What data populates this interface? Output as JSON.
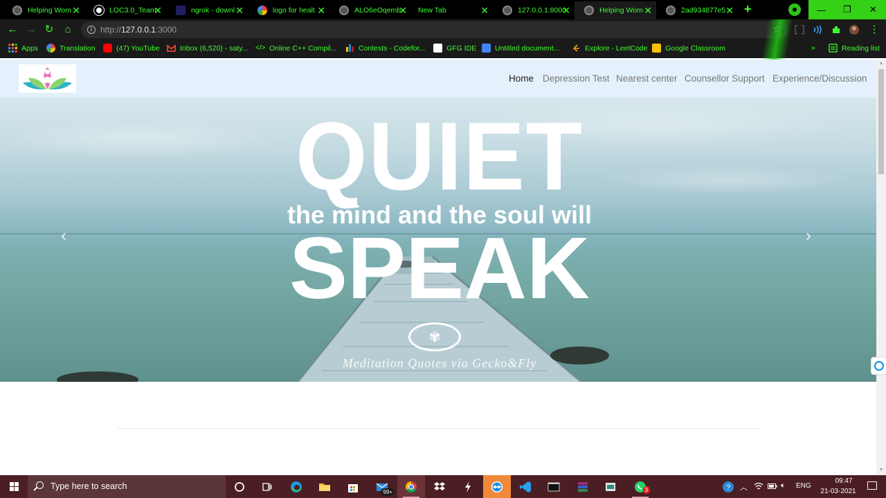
{
  "browser": {
    "tabs": [
      {
        "title": "Helping Wom",
        "favicon": "globe-icon"
      },
      {
        "title": "LOC3.0_Team",
        "favicon": "github-icon"
      },
      {
        "title": "ngrok - downl",
        "favicon": "ngrok-icon"
      },
      {
        "title": "logo for healt",
        "favicon": "google-icon"
      },
      {
        "title": "ALO6eOqemb",
        "favicon": "globe-icon"
      },
      {
        "title": "New Tab",
        "favicon": "none"
      },
      {
        "title": "127.0.0.1:8000",
        "favicon": "globe-icon"
      },
      {
        "title": "Helping Wom",
        "favicon": "globe-icon",
        "active": true
      },
      {
        "title": "2ad934877e5",
        "favicon": "globe-icon"
      }
    ],
    "url_host": "http://",
    "url_domain": "127.0.0.1",
    "url_port": ":3000",
    "accent_color": "#3dff2e",
    "bookmarks": [
      {
        "label": "Apps",
        "icon": "apps-grid-icon"
      },
      {
        "label": "Translation",
        "icon": "google-icon"
      },
      {
        "label": "(47) YouTube",
        "icon": "youtube-icon"
      },
      {
        "label": "Inbox (6,520) - saty...",
        "icon": "gmail-icon"
      },
      {
        "label": "Online C++ Compil...",
        "icon": "code-icon"
      },
      {
        "label": "Contests - Codefor...",
        "icon": "codeforces-icon"
      },
      {
        "label": "GFG IDE",
        "icon": "gfg-icon"
      },
      {
        "label": "Untitled document...",
        "icon": "docs-icon"
      },
      {
        "label": "Explore - LeetCode",
        "icon": "leetcode-icon"
      },
      {
        "label": "Google Classroom",
        "icon": "classroom-icon"
      }
    ],
    "reading_list": "Reading list",
    "overflow": "»"
  },
  "site": {
    "nav": [
      {
        "label": "Home",
        "active": true
      },
      {
        "label": "Depression Test"
      },
      {
        "label": "Nearest center"
      },
      {
        "label": "Counsellor Support"
      },
      {
        "label": "Experience/Discussion"
      }
    ],
    "carousel": {
      "line1": "QUIET",
      "line2": "the mind and the soul will",
      "line3": "SPEAK",
      "credit": "Meditation Quotes via Gecko&Fly",
      "prev": "‹",
      "next": "›"
    }
  },
  "taskbar": {
    "search_placeholder": "Type here to search",
    "mail_badge": "99+",
    "whatsapp_badge": "3",
    "language": "ENG",
    "time": "09:47",
    "date": "21-03-2021"
  }
}
